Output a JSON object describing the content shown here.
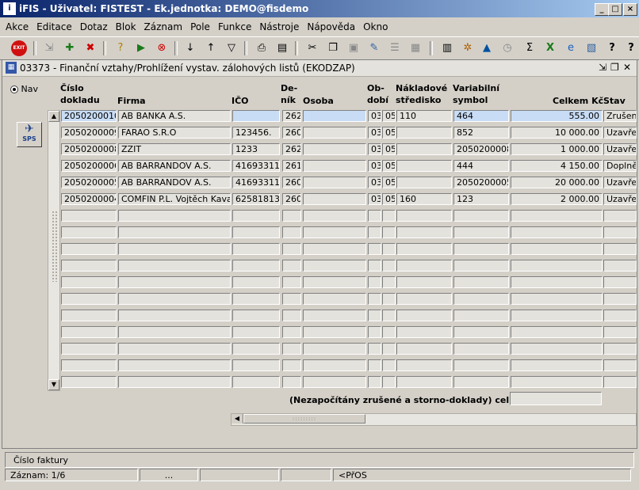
{
  "window": {
    "title": "iFIS - Uživatel: FISTEST - Ek.jednotka: DEMO@fisdemo"
  },
  "menu": [
    "Akce",
    "Editace",
    "Dotaz",
    "Blok",
    "Záznam",
    "Pole",
    "Funkce",
    "Nástroje",
    "Nápověda",
    "Okno"
  ],
  "toolbar": {
    "exit_label": "EXIT",
    "sps_label": "SPS"
  },
  "form": {
    "title": "03373 - Finanční vztahy/Prohlížení vystav. zálohových listů (EKODZAP)",
    "nav_label": "Nav",
    "headers": {
      "cislo": "Číslo dokladu",
      "firma": "Firma",
      "ico": "IČO",
      "denik": "De-ník",
      "osoba": "Osoba",
      "obdobi": "Ob-dobí",
      "stredisko": "Nákladové středisko",
      "symbol": "Variabilní symbol",
      "celkem": "Celkem Kč",
      "stav": "Stav"
    },
    "rows": [
      {
        "cislo": "2050200010",
        "firma": "AB BANKA A.S.",
        "ico": "",
        "denik": "262",
        "osoba": "",
        "m": "03",
        "r": "05",
        "stredisko": "110",
        "symbol": "464",
        "celkem": "555.00",
        "stav": "Zrušen"
      },
      {
        "cislo": "2050200009",
        "firma": "FARAO S.R.O",
        "ico": "123456.",
        "denik": "260",
        "osoba": "",
        "m": "03",
        "r": "05",
        "stredisko": "",
        "symbol": "852",
        "celkem": "10 000.00",
        "stav": "Uzavřen"
      },
      {
        "cislo": "2050200008",
        "firma": "ZZIT",
        "ico": "1233",
        "denik": "262",
        "osoba": "",
        "m": "03",
        "r": "05",
        "stredisko": "",
        "symbol": "2050200008",
        "celkem": "1 000.00",
        "stav": "Uzavřen"
      },
      {
        "cislo": "2050200006",
        "firma": "AB BARRANDOV A.S.",
        "ico": "41693311",
        "denik": "261",
        "osoba": "",
        "m": "03",
        "r": "05",
        "stredisko": "",
        "symbol": "444",
        "celkem": "4 150.00",
        "stav": "Doplněn"
      },
      {
        "cislo": "2050200005",
        "firma": "AB BARRANDOV A.S.",
        "ico": "41693311",
        "denik": "260",
        "osoba": "",
        "m": "03",
        "r": "05",
        "stredisko": "",
        "symbol": "2050200005",
        "celkem": "20 000.00",
        "stav": "Uzavřen"
      },
      {
        "cislo": "2050200004",
        "firma": "COMFIN P.L. Vojtěch Kavan",
        "ico": "62581813",
        "denik": "260",
        "osoba": "",
        "m": "03",
        "r": "05",
        "stredisko": "160",
        "symbol": "123",
        "celkem": "2 000.00",
        "stav": "Uzavřen"
      }
    ],
    "summary_label": "(Nezapočítány zrušené a storno-doklady) celkem"
  },
  "status": {
    "hint": "Číslo faktury",
    "record": "Záznam: 1/6",
    "dots": "...",
    "mode": "<PřOS"
  }
}
